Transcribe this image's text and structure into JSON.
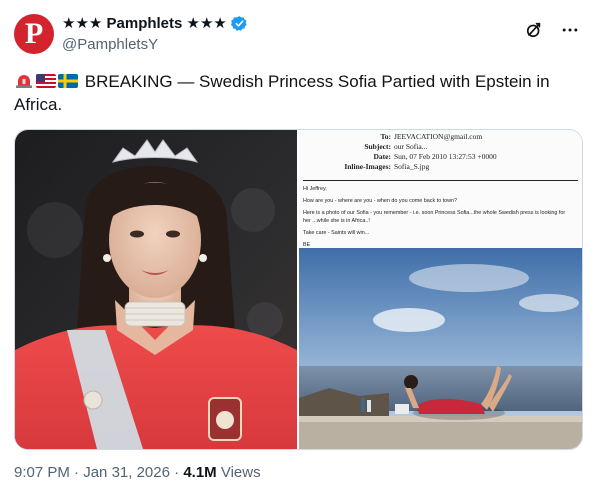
{
  "account": {
    "display_name": "★★★ Pamphlets ★★★",
    "handle": "@PamphletsY",
    "avatar_letter": "P"
  },
  "post": {
    "text": "BREAKING — Swedish Princess Sofia Partied with Epstein in Africa.",
    "flags": [
      "siren",
      "usa",
      "sweden"
    ]
  },
  "email": {
    "to_label": "To:",
    "to": "JEEVACATION@gmail.com",
    "subject_label": "Subject:",
    "subject": "our Sofia...",
    "date_label": "Date:",
    "date": "Sun, 07 Feb 2010 13:27:53 +0000",
    "images_label": "Inline-Images:",
    "images": "Sofia_S.jpg",
    "body_1": "Hi Jeffrey,",
    "body_2": "How are you - where are you - when do you come back to town?",
    "body_3": "Here is a photo of our Sofia - you remember - i.e. soon Princess Sofia...the whole Swedish press is looking for her ...while she is in Africa..!",
    "body_4": "Take care - Saints will win...",
    "body_5": "BE"
  },
  "footer": {
    "time": "9:07 PM",
    "sep1": " · ",
    "date": "Jan 31, 2026",
    "sep2": " · ",
    "views_count": "4.1M",
    "views_label": " Views"
  },
  "colors": {
    "avatar_bg": "#d3232c",
    "verified": "#1d9bf0",
    "meta_gray": "#536471",
    "border": "#cfd9de"
  },
  "icons": [
    "verified-badge-icon",
    "grok-icon",
    "more-icon"
  ]
}
